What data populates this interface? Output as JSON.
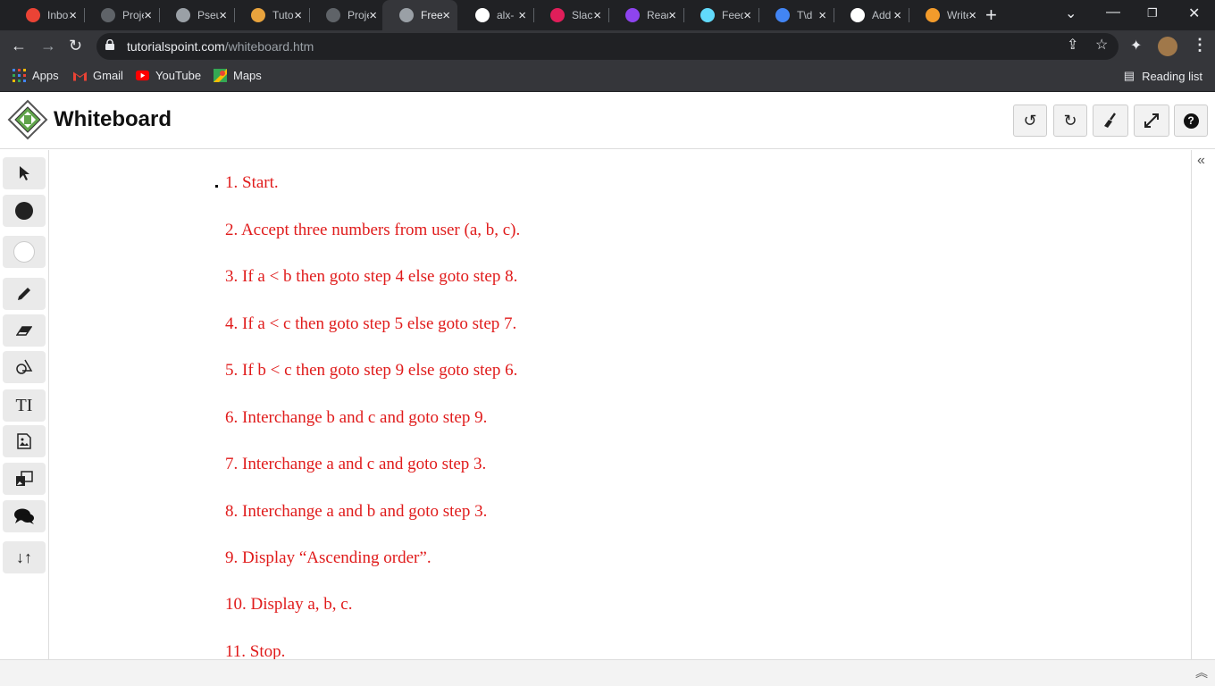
{
  "browser": {
    "tabs": [
      {
        "title": "Inbox",
        "icon": "gmail-icon",
        "color": "#ea4335"
      },
      {
        "title": "Projects",
        "icon": "alx-icon",
        "color": "#5f6368"
      },
      {
        "title": "Pseudocode",
        "icon": "gear-icon",
        "color": "#9aa0a6"
      },
      {
        "title": "Tutorials",
        "icon": "tutorial-icon",
        "color": "#e8a33d"
      },
      {
        "title": "Projects",
        "icon": "alx-icon",
        "color": "#5f6368"
      },
      {
        "title": "Free",
        "icon": "tutorialspoint-icon",
        "color": "#9aa0a6"
      },
      {
        "title": "alx-",
        "icon": "github-icon",
        "color": "#ffffff"
      },
      {
        "title": "Slack",
        "icon": "slack-icon",
        "color": "#e01e5a"
      },
      {
        "title": "Read",
        "icon": "reader-icon",
        "color": "#8e44ef"
      },
      {
        "title": "Feed",
        "icon": "react-icon",
        "color": "#61dafb"
      },
      {
        "title": "T\\d",
        "icon": "google-icon",
        "color": "#4285f4"
      },
      {
        "title": "Add",
        "icon": "github-icon",
        "color": "#ffffff"
      },
      {
        "title": "Write",
        "icon": "quora-icon",
        "color": "#f29b2b"
      }
    ],
    "url_domain": "tutorialspoint.com",
    "url_path": "/whiteboard.htm",
    "bookmarks": [
      "Apps",
      "Gmail",
      "YouTube",
      "Maps"
    ],
    "reading_list": "Reading list"
  },
  "header": {
    "title": "Whiteboard"
  },
  "steps": [
    "1. Start.",
    "2. Accept three numbers from user (a, b, c).",
    "3. If a < b then goto step 4 else goto step 8.",
    "4. If a < c then goto step 5 else goto step 7.",
    "5. If b < c then goto step 9 else goto step 6.",
    "6. Interchange b and c and goto step 9.",
    "7. Interchange a and c and goto step 3.",
    "8. Interchange a and b and goto step 3.",
    "9. Display “Ascending order”.",
    "10. Display a, b, c.",
    "11. Stop."
  ],
  "text_color": "#e01b1b",
  "tools": [
    "pointer-tool",
    "fill-color-tool",
    "stroke-color-tool",
    "pencil-tool",
    "eraser-tool",
    "shapes-tool",
    "text-tool",
    "image-tool",
    "media-tool",
    "comment-tool",
    "sort-tool"
  ],
  "page_actions": [
    "add-page",
    "delete-page",
    "page-list"
  ]
}
